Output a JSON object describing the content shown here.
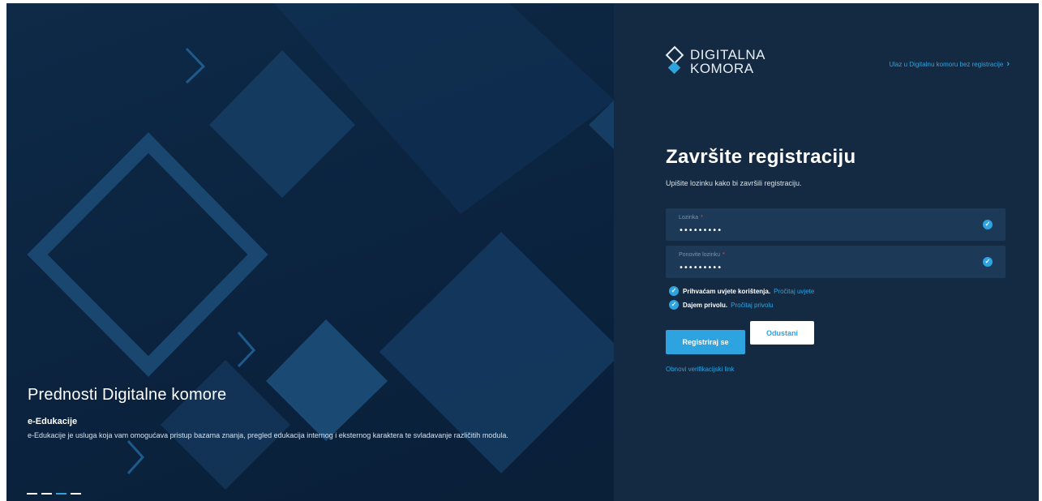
{
  "hero": {
    "title": "Prednosti Digitalne komore",
    "feature_title": "e-Edukacije",
    "feature_description": "e-Edukacije je usluga koja vam omogućava pristup bazama znanja, pregled edukacija internog i eksternog karaktera te svladavanje različitih modula.",
    "slides": 4,
    "active_slide": 3
  },
  "header": {
    "logo_line1": "DIGITALNA",
    "logo_line2": "KOMORA",
    "guest_link": "Ulaz u Digitalnu komoru bez registracije",
    "guest_link_icon": "chevron-right-icon"
  },
  "form": {
    "title": "Završite registraciju",
    "subtitle": "Upišite lozinku kako bi završili registraciju.",
    "password_label": "Lozinka",
    "password_value": "•••••••••",
    "repeat_label": "Ponovite lozinku",
    "repeat_value": "•••••••••",
    "required_mark": "*",
    "valid_icon": "check-circle-icon",
    "terms_text": "Prihvaćam uvjete korištenja.",
    "terms_link": "Pročitaj uvjete",
    "consent_text": "Dajem privolu.",
    "consent_link": "Pročitaj privolu",
    "register_button": "Registriraj se",
    "cancel_button": "Odustani",
    "resend_link": "Obnovi verifikacijski link"
  },
  "colors": {
    "accent": "#2da3e0",
    "panel_bg": "#132a42",
    "hero_bg": "#0b2440",
    "field_bg": "#1c3a57"
  }
}
